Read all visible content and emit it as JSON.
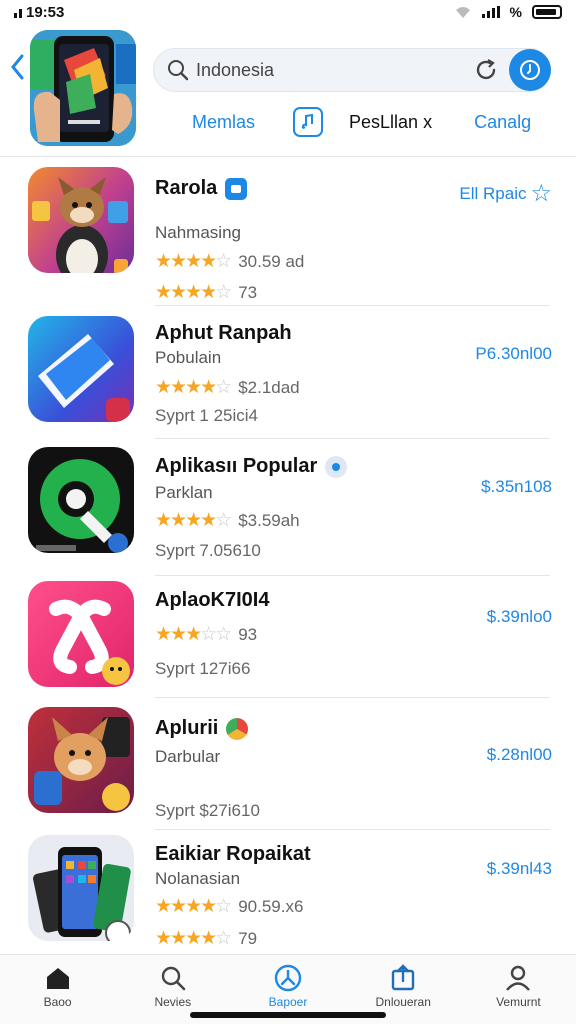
{
  "status_bar": {
    "time": "19:53",
    "battery_label": "%"
  },
  "header": {
    "search_value": "Indonesia",
    "filters": [
      "Memlas",
      "PesLllan x",
      "Canalg"
    ]
  },
  "apps": [
    {
      "title": "Rarola",
      "subtitle": "Nahmasing",
      "rating_text": "30.59 ad",
      "meta": "73",
      "price": "Ell Rpaic",
      "stars": 4
    },
    {
      "title": "Aphut Ranpah",
      "subtitle": "Pobulain",
      "rating_text": "$2.1dad",
      "meta": "Syprt 1 25ici4",
      "price": "P6.30nl00",
      "stars": 4
    },
    {
      "title": "Aplikasıı Popular",
      "subtitle": "Parklan",
      "rating_text": "$3.59ah",
      "meta": "Syprt 7.05610",
      "price": "$.35n108",
      "stars": 4
    },
    {
      "title": "AplaoK7I0I4",
      "subtitle": "",
      "rating_text": "93",
      "meta": "Syprt 127i66",
      "price": "$.39nlo0",
      "stars": 3
    },
    {
      "title": "Aplurii",
      "subtitle": "Darbular",
      "rating_text": "",
      "meta": "Syprt $27i610",
      "price": "$.28nl00",
      "stars": 0
    },
    {
      "title": "Eaikiar Ropaikat",
      "subtitle": "Nolanasian",
      "rating_text": "90.59.x6",
      "meta": "79",
      "price": "$.39nl43",
      "stars": 4
    }
  ],
  "tabs": [
    {
      "label": "Baoo",
      "icon": "home-icon"
    },
    {
      "label": "Nevies",
      "icon": "search-icon"
    },
    {
      "label": "Bapoer",
      "icon": "apps-icon"
    },
    {
      "label": "Dnloueran",
      "icon": "download-icon"
    },
    {
      "label": "Vemurnt",
      "icon": "account-icon"
    }
  ],
  "colors": {
    "accent": "#1e88e5",
    "star": "#f5a623"
  }
}
